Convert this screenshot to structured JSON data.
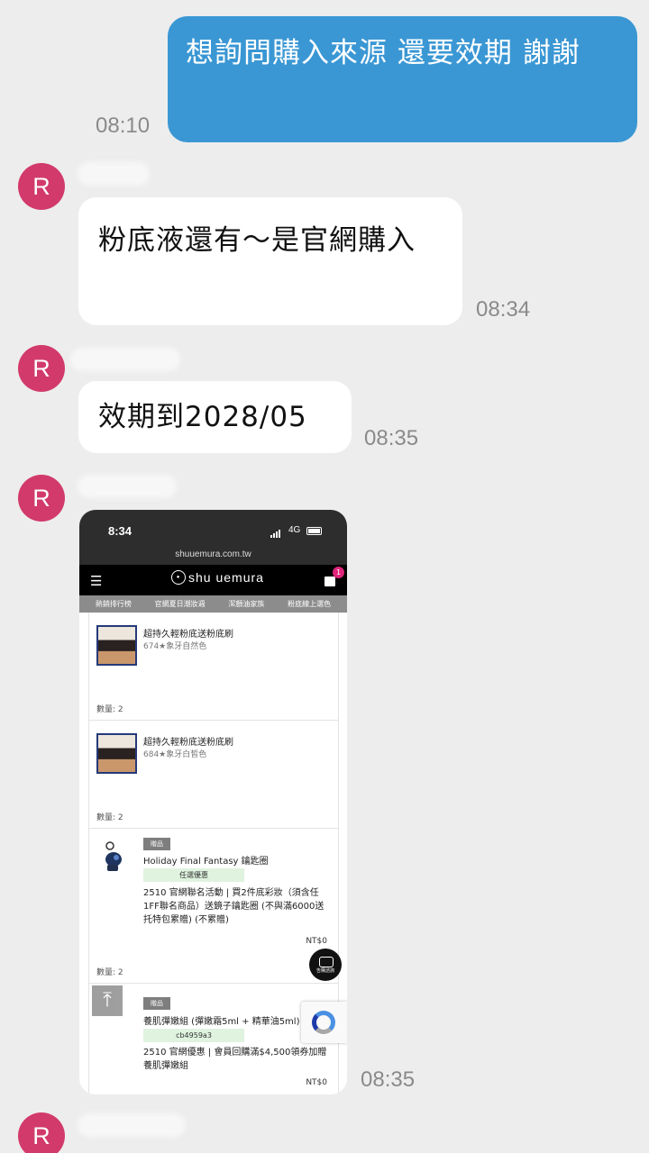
{
  "messages": {
    "outgoing": {
      "text": "想詢問購入來源 還要效期 謝謝",
      "time": "08:10"
    },
    "in1": {
      "avatar": "R",
      "text": "粉底液還有～是官網購入",
      "time": "08:34"
    },
    "in2": {
      "avatar": "R",
      "text": "效期到2028/05",
      "time": "08:35"
    },
    "in3": {
      "avatar": "R",
      "time": "08:35"
    },
    "in4": {
      "avatar": "R"
    }
  },
  "screenshot": {
    "status": {
      "clock": "8:34",
      "network": "4G"
    },
    "url": "shuuemura.com.tw",
    "brand": "shu uemura",
    "cart_count": "1",
    "nav": [
      "熱銷排行榜",
      "官網夏日潮妝週",
      "潔顏油家族",
      "粉底線上選色"
    ],
    "items": [
      {
        "name": "超持久輕粉底送粉底刷",
        "variant": "674★象牙自然色",
        "qty": "數量: 2"
      },
      {
        "name": "超持久輕粉底送粉底刷",
        "variant": "684★象牙白皙色",
        "qty": "數量: 2"
      },
      {
        "tag": "贈品",
        "name": "Holiday Final Fantasy 鑰匙圈",
        "promo": "任選優惠",
        "desc": "2510 官網聯名活動 | 買2件底彩妝（須含任1FF聯名商品）送鏡子鑰匙圈 (不與滿6000送托特包累贈) (不累贈)",
        "price": "NT$0",
        "qty": "數量: 2"
      },
      {
        "tag": "贈品",
        "name": "養肌彈嫩組 (彈嫩霜5ml + 精華油5ml)",
        "promo": "cb4959a3",
        "desc": "2510 官網優惠 | 會員回購滿$4,500領券加贈養肌彈嫩組",
        "price": "NT$0"
      }
    ],
    "chat_label": "告購諮詢"
  }
}
